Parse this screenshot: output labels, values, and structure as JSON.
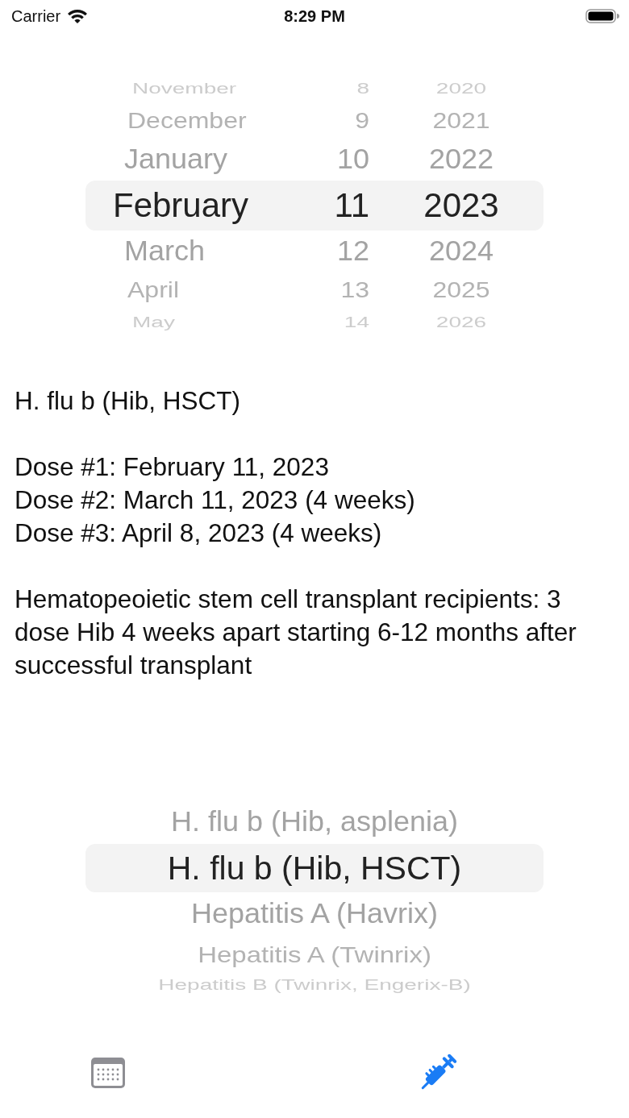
{
  "status_bar": {
    "carrier": "Carrier",
    "time": "8:29 PM"
  },
  "date_picker": {
    "months": [
      {
        "label": "November",
        "selected": false
      },
      {
        "label": "December",
        "selected": false
      },
      {
        "label": "January",
        "selected": false
      },
      {
        "label": "February",
        "selected": true
      },
      {
        "label": "March",
        "selected": false
      },
      {
        "label": "April",
        "selected": false
      },
      {
        "label": "May",
        "selected": false
      }
    ],
    "days": [
      {
        "label": "8",
        "selected": false
      },
      {
        "label": "9",
        "selected": false
      },
      {
        "label": "10",
        "selected": false
      },
      {
        "label": "11",
        "selected": true
      },
      {
        "label": "12",
        "selected": false
      },
      {
        "label": "13",
        "selected": false
      },
      {
        "label": "14",
        "selected": false
      }
    ],
    "years": [
      {
        "label": "2020",
        "selected": false
      },
      {
        "label": "2021",
        "selected": false
      },
      {
        "label": "2022",
        "selected": false
      },
      {
        "label": "2023",
        "selected": true
      },
      {
        "label": "2024",
        "selected": false
      },
      {
        "label": "2025",
        "selected": false
      },
      {
        "label": "2026",
        "selected": false
      }
    ]
  },
  "result": {
    "title": "H. flu b (Hib, HSCT)",
    "doses": [
      "Dose #1: February 11, 2023",
      "Dose #2: March 11, 2023 (4 weeks)",
      "Dose #3: April 8, 2023 (4 weeks)"
    ],
    "note": "Hematopeoietic stem cell transplant recipients: 3 dose Hib 4 weeks apart starting 6-12 months after successful transplant"
  },
  "vaccine_picker": {
    "items": [
      {
        "label": "H. flu b (Hib, asplenia)",
        "selected": false
      },
      {
        "label": "H. flu b (Hib, HSCT)",
        "selected": true
      },
      {
        "label": "Hepatitis A (Havrix)",
        "selected": false
      },
      {
        "label": "Hepatitis A (Twinrix)",
        "selected": false
      },
      {
        "label": "Hepatitis B (Twinrix, Engerix-B)",
        "selected": false
      }
    ]
  },
  "tab_bar": {
    "tabs": [
      {
        "kind": "calendar",
        "selected": false
      },
      {
        "kind": "syringe",
        "selected": true
      }
    ]
  }
}
